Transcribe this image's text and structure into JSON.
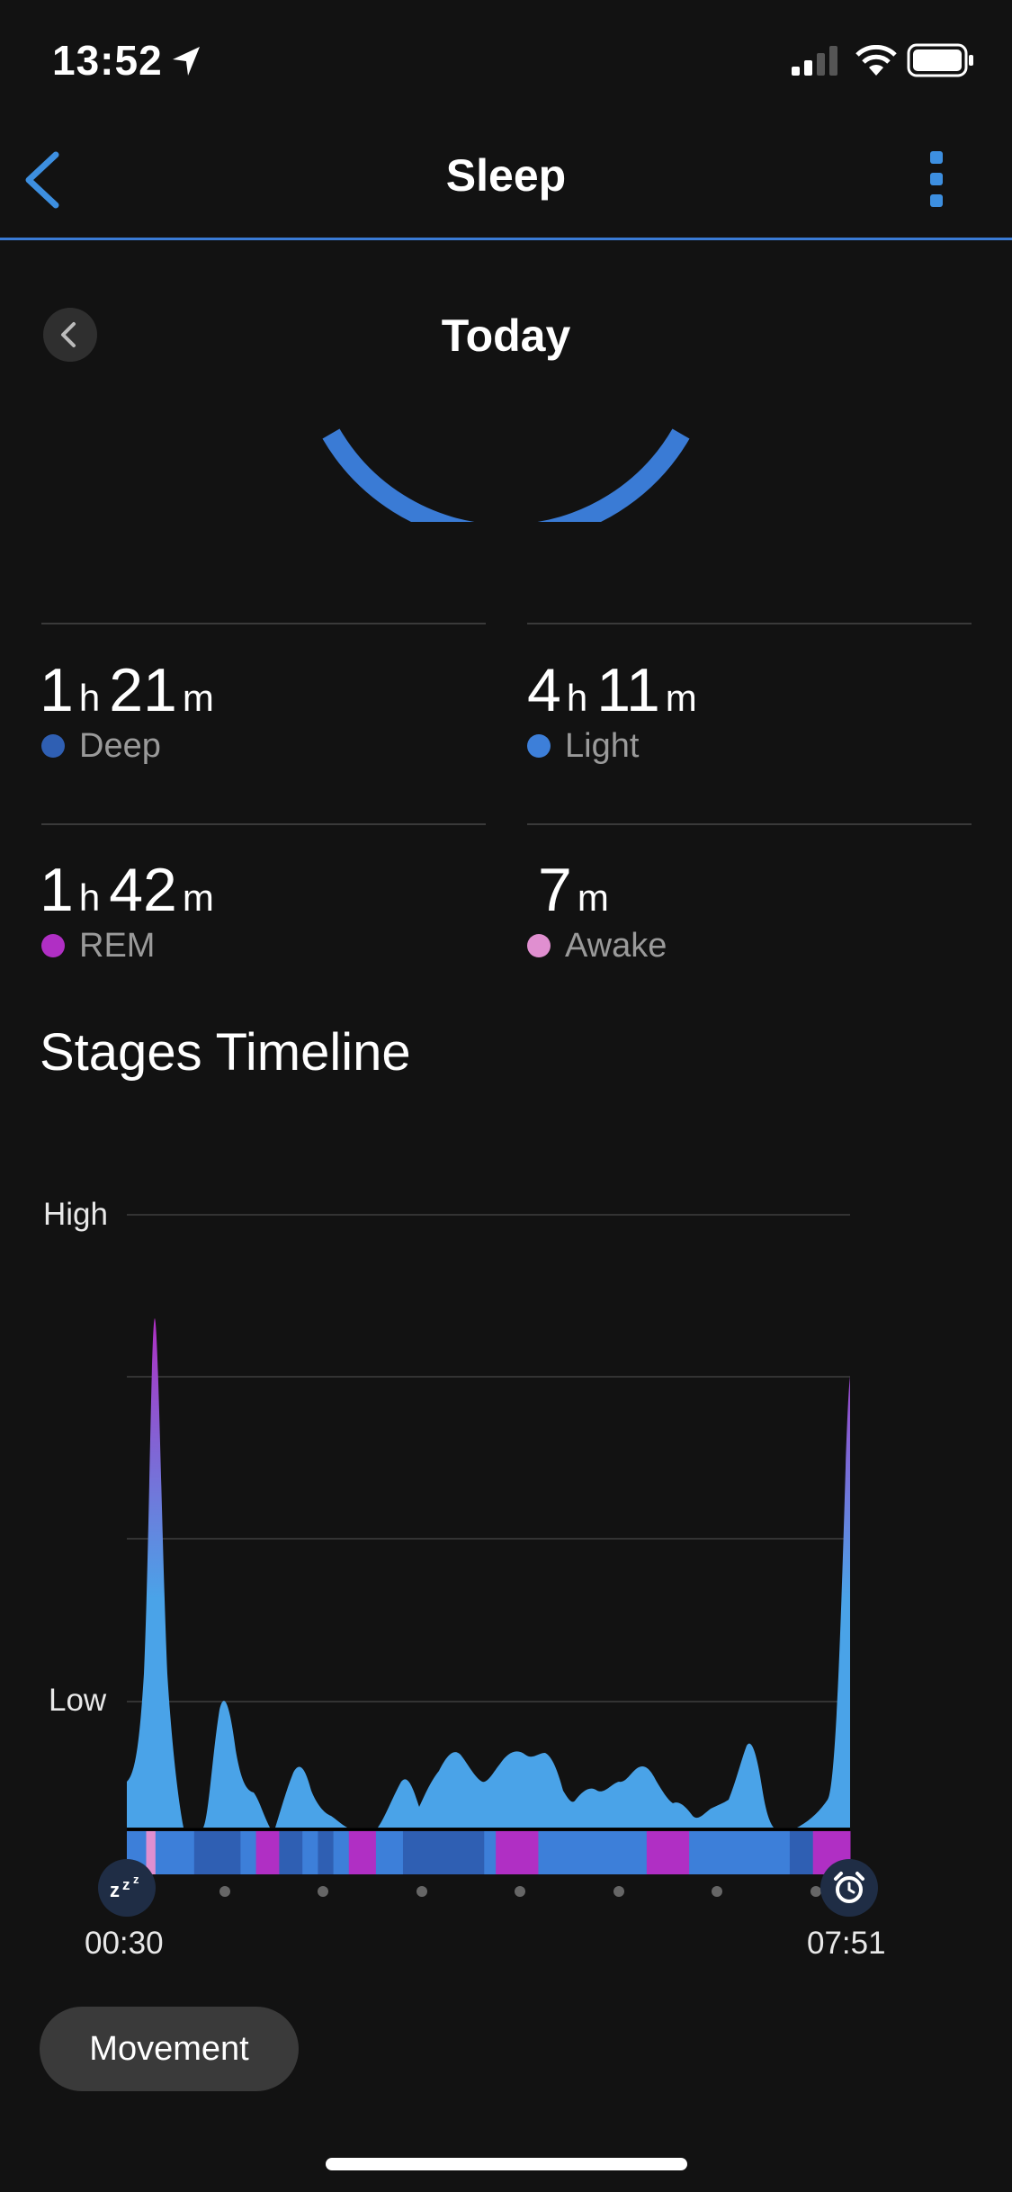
{
  "status_bar": {
    "time": "13:52"
  },
  "header": {
    "title": "Sleep"
  },
  "day": {
    "title": "Today"
  },
  "stats": [
    {
      "h": "1",
      "h_unit": "h",
      "m": "21",
      "m_unit": "m",
      "label": "Deep",
      "color": "#2f5fb3"
    },
    {
      "h": "4",
      "h_unit": "h",
      "m": "11",
      "m_unit": "m",
      "label": "Light",
      "color": "#3d7fd9"
    },
    {
      "h": "1",
      "h_unit": "h",
      "m": "42",
      "m_unit": "m",
      "label": "REM",
      "color": "#b02fc4"
    },
    {
      "m": "7",
      "m_unit": "m",
      "label": "Awake",
      "color": "#e08fd0"
    }
  ],
  "stages_timeline": {
    "title": "Stages Timeline",
    "y_high_label": "High",
    "y_low_label": "Low",
    "start_time": "00:30",
    "end_time": "07:51"
  },
  "movement_button": {
    "label": "Movement"
  },
  "colors": {
    "accent": "#3d8fe0",
    "deep": "#2f5fb3",
    "light": "#3d7fd9",
    "rem": "#b02fc4",
    "awake": "#e08fd0",
    "area": "#4aa3e8"
  },
  "chart_data": {
    "type": "area",
    "y_levels": [
      "Low",
      "High"
    ],
    "x_range": [
      "00:30",
      "07:51"
    ],
    "stage_bar": [
      [
        "light",
        0.025
      ],
      [
        "awake",
        0.012
      ],
      [
        "light",
        0.05
      ],
      [
        "deep",
        0.06
      ],
      [
        "light",
        0.02
      ],
      [
        "rem",
        0.03
      ],
      [
        "deep",
        0.03
      ],
      [
        "light",
        0.02
      ],
      [
        "deep",
        0.02
      ],
      [
        "light",
        0.02
      ],
      [
        "rem",
        0.035
      ],
      [
        "light",
        0.035
      ],
      [
        "deep",
        0.105
      ],
      [
        "light",
        0.015
      ],
      [
        "rem",
        0.055
      ],
      [
        "light",
        0.14
      ],
      [
        "rem",
        0.055
      ],
      [
        "light",
        0.13
      ],
      [
        "deep",
        0.03
      ],
      [
        "rem",
        0.048
      ]
    ]
  }
}
